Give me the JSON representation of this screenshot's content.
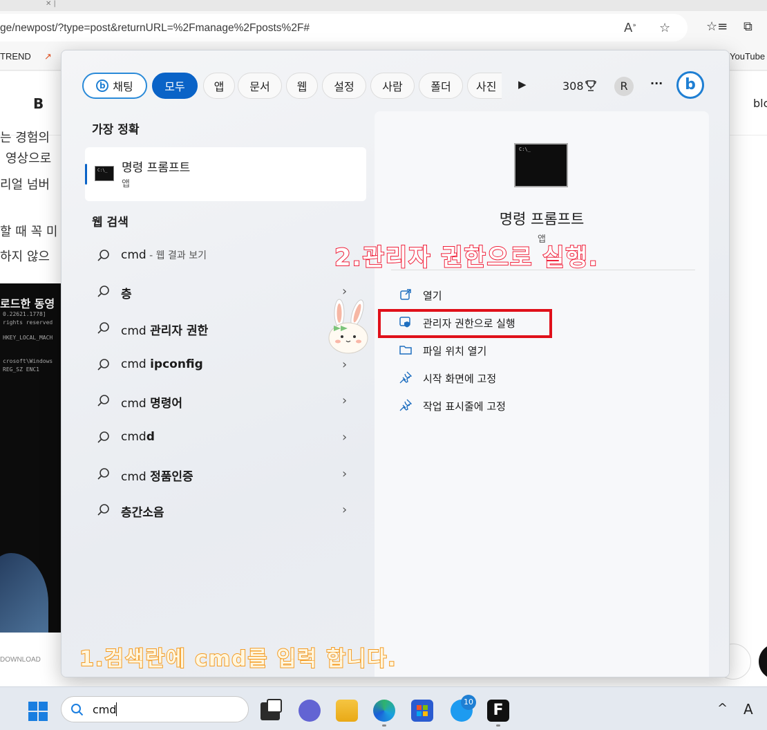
{
  "browser": {
    "url": "ge/newpost/?type=post&returnURL=%2Fmanage%2Fposts%2F#",
    "bookmarks": [
      "TREND",
      "YouTube"
    ]
  },
  "page_behind": {
    "toolbar_bold": "B",
    "toolbar_right": "blc",
    "lines": [
      "는 경험의",
      "영상으로",
      "리얼 넘버",
      "할 때 꼭 미",
      "하지 않으"
    ],
    "video_title": "로드한 동영",
    "video_lines": [
      "0.22621.1778]",
      "rights reserved",
      "HKEY_LOCAL_MACH",
      "crosoft\\Windows",
      "REG_SZ      ENC1"
    ],
    "download_label": "DOWNLOAD"
  },
  "search_panel": {
    "chips": [
      {
        "label": "채팅",
        "active": false,
        "bing": true
      },
      {
        "label": "모두",
        "active": true
      },
      {
        "label": "앱",
        "active": false
      },
      {
        "label": "문서",
        "active": false
      },
      {
        "label": "웹",
        "active": false
      },
      {
        "label": "설정",
        "active": false
      },
      {
        "label": "사람",
        "active": false
      },
      {
        "label": "폴더",
        "active": false
      },
      {
        "label": "사진",
        "active": false
      }
    ],
    "play_symbol": "▶",
    "points": "308",
    "avatar": "R",
    "more": "···",
    "bing_logo": "b",
    "best_match_heading": "가장 정확",
    "best_match": {
      "title": "명령 프롬프트",
      "subtitle": "앱"
    },
    "web_heading": "웹 검색",
    "web_results": [
      {
        "prefix": "cmd",
        "bold": "",
        "suffix": " - 웹 결과 보기",
        "chevron": false
      },
      {
        "prefix": "",
        "bold": "층",
        "suffix": "",
        "chevron": true
      },
      {
        "prefix": "cmd ",
        "bold": "관리자 권한",
        "suffix": "",
        "chevron": false
      },
      {
        "prefix": "cmd ",
        "bold": "ipconfig",
        "suffix": "",
        "chevron": true
      },
      {
        "prefix": "cmd ",
        "bold": "명령어",
        "suffix": "",
        "chevron": true
      },
      {
        "prefix": "cmd",
        "bold": "d",
        "suffix": "",
        "chevron": true
      },
      {
        "prefix": "cmd ",
        "bold": "정품인증",
        "suffix": "",
        "chevron": true
      },
      {
        "prefix": "",
        "bold": "층간소음",
        "suffix": "",
        "chevron": true
      }
    ],
    "chevron_symbol": "›",
    "detail": {
      "title": "명령 프롬프트",
      "subtitle": "앱",
      "icon_text": "C:\\_",
      "actions": [
        {
          "label": "열기",
          "icon": "open-external-icon"
        },
        {
          "label": "관리자 권한으로 실행",
          "icon": "admin-shield-icon"
        },
        {
          "label": "파일 위치 열기",
          "icon": "folder-icon"
        },
        {
          "label": "시작 화면에 고정",
          "icon": "pin-icon"
        },
        {
          "label": "작업 표시줄에 고정",
          "icon": "pin-icon"
        }
      ]
    }
  },
  "annotations": {
    "step1": "1.검색란에 cmd를 입력 합니다.",
    "step2": "2.관리자 권한으로 실행."
  },
  "taskbar": {
    "search_text": "cmd",
    "twitter_badge": "10",
    "tray_chevron": "^",
    "tray_lang": "A",
    "f_app": "F"
  },
  "colors": {
    "accent": "#0a63c7",
    "highlight_box": "#e0101a"
  }
}
